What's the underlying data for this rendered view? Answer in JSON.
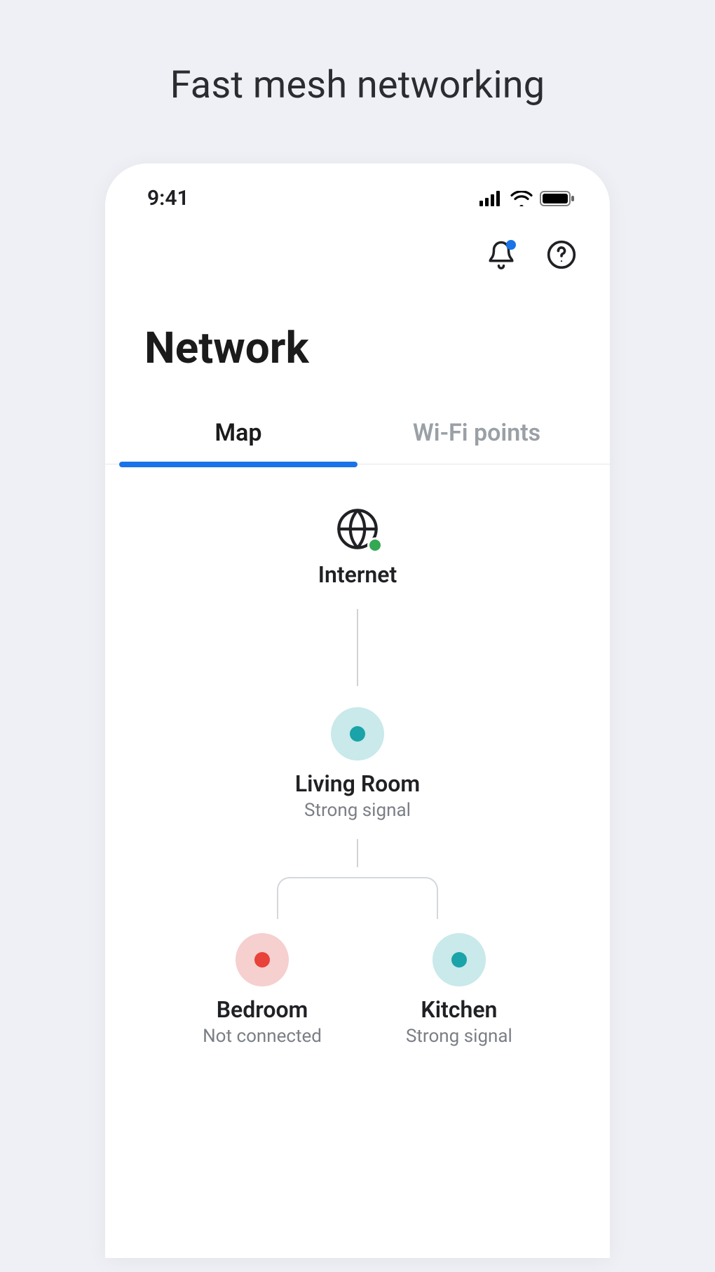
{
  "marketing_title": "Fast mesh networking",
  "status_bar": {
    "time": "9:41"
  },
  "screen_title": "Network",
  "tabs": [
    {
      "label": "Map",
      "active": true
    },
    {
      "label": "Wi-Fi points",
      "active": false
    }
  ],
  "nodes": {
    "internet": {
      "label": "Internet"
    },
    "primary": {
      "label": "Living Room",
      "subtitle": "Strong signal"
    },
    "children": [
      {
        "label": "Bedroom",
        "subtitle": "Not connected",
        "status": "bad"
      },
      {
        "label": "Kitchen",
        "subtitle": "Strong signal",
        "status": "good"
      }
    ]
  },
  "colors": {
    "accent": "#1a73e8",
    "ok": "#34a853",
    "bad": "#e8423a",
    "teal": "#1aa3a8"
  }
}
